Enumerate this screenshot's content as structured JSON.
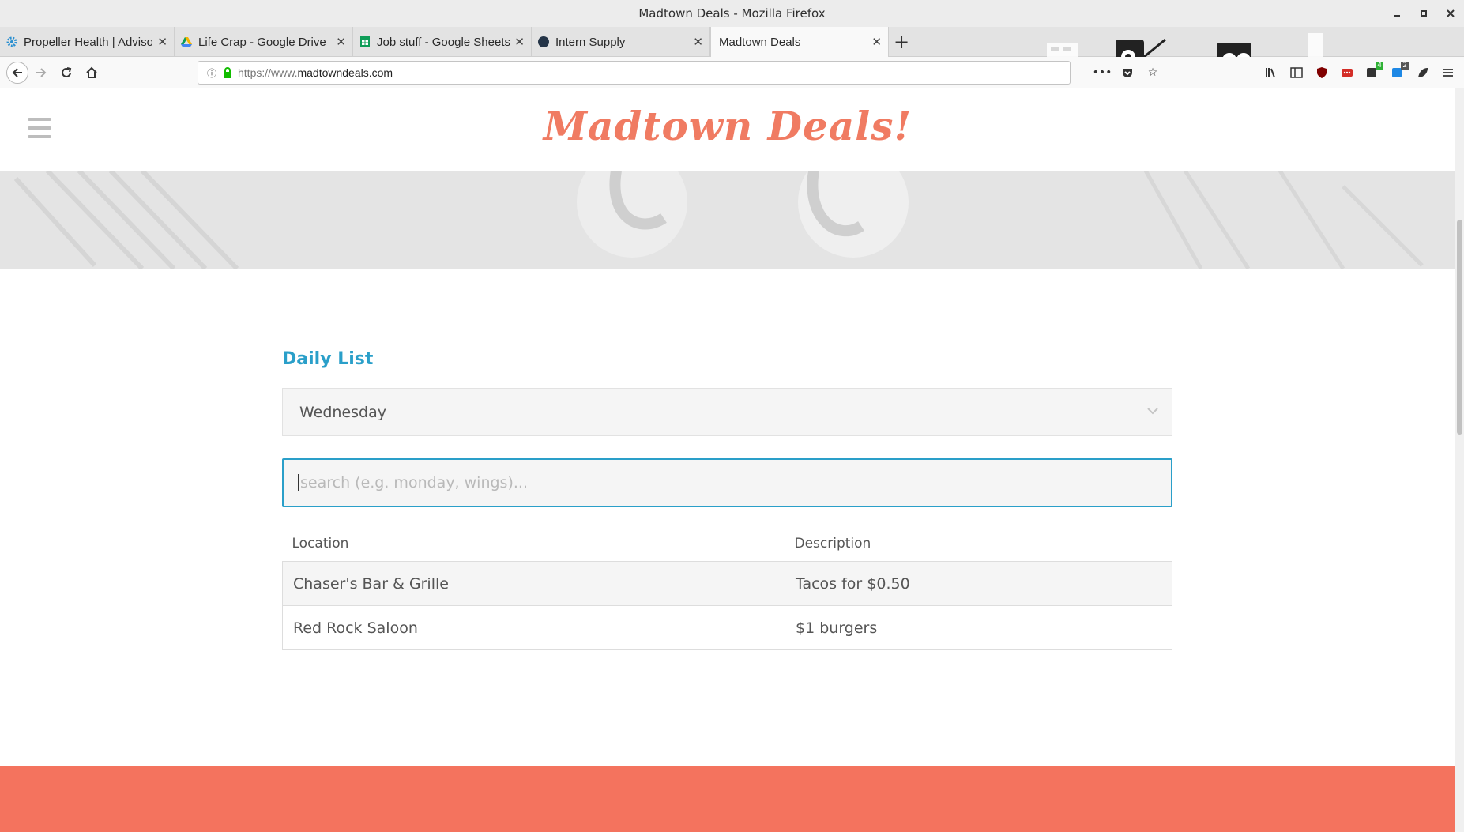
{
  "window": {
    "title": "Madtown Deals - Mozilla Firefox",
    "controls": [
      "minimize",
      "maximize",
      "close"
    ]
  },
  "tabs": [
    {
      "label": "Propeller Health | Advisor",
      "favicon": "gear-icon",
      "color": "#2a8fd0"
    },
    {
      "label": "Life Crap - Google Drive",
      "favicon": "drive-icon",
      "color": "#f4b400"
    },
    {
      "label": "Job stuff - Google Sheets",
      "favicon": "sheets-icon",
      "color": "#0f9d58"
    },
    {
      "label": "Intern Supply",
      "favicon": "circle-icon",
      "color": "#243447"
    },
    {
      "label": "Madtown Deals",
      "favicon": "",
      "color": ""
    }
  ],
  "active_tab_index": 4,
  "urlbar": {
    "prefix": "https://www.",
    "domain": "madtowndeals.com"
  },
  "toolbar_badges": {
    "ext3_count": "4",
    "ext4_count": "2"
  },
  "site": {
    "logo": "Madtown Deals!",
    "section_title": "Daily List",
    "day_select": {
      "selected": "Wednesday"
    },
    "search": {
      "placeholder": "search (e.g. monday, wings)...",
      "value": ""
    },
    "table": {
      "headers": [
        "Location",
        "Description"
      ],
      "rows": [
        {
          "location": "Chaser's Bar & Grille",
          "description": "Tacos for $0.50"
        },
        {
          "location": "Red Rock Saloon",
          "description": "$1 burgers"
        }
      ]
    }
  },
  "colors": {
    "logo": "#f07b62",
    "accent": "#2a9fc9",
    "footer": "#f4735e"
  }
}
